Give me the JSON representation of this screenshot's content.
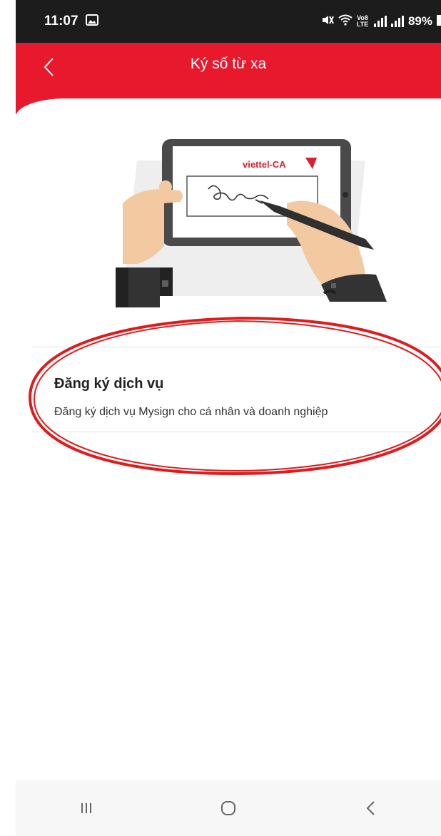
{
  "status_bar": {
    "time": "11:07",
    "battery": "89%",
    "network_label": "Vo8 LTE"
  },
  "header": {
    "title": "Ký số từ xa",
    "back_icon": "chevron-left-icon",
    "color": "#e8192c"
  },
  "illustration": {
    "brand_text": "viettel-CA"
  },
  "service": {
    "title": "Đăng ký dịch vụ",
    "description": "Đăng ký dịch vụ Mysign cho cá nhân và doanh nghiệp"
  },
  "annotation": {
    "color": "#e01b1b"
  },
  "nav": {
    "recents_icon": "recents-icon",
    "home_icon": "home-icon",
    "back_icon": "back-icon"
  }
}
